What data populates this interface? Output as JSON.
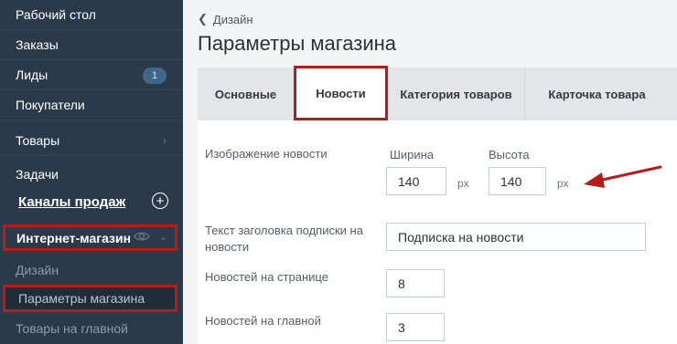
{
  "sidebar": {
    "items": [
      {
        "label": "Рабочий стол"
      },
      {
        "label": "Заказы"
      },
      {
        "label": "Лиды",
        "badge": "1"
      },
      {
        "label": "Покупатели"
      },
      {
        "label": "Товары"
      },
      {
        "label": "Задачи"
      }
    ],
    "channels_label": "Каналы продаж",
    "shop_label": "Интернет-магазин",
    "sub_items": [
      {
        "label": "Дизайн"
      },
      {
        "label": "Параметры магазина"
      },
      {
        "label": "Товары на главной"
      }
    ]
  },
  "breadcrumb": {
    "label": "Дизайн"
  },
  "page": {
    "title": "Параметры магазина"
  },
  "tabs": [
    {
      "label": "Основные"
    },
    {
      "label": "Новости"
    },
    {
      "label": "Категория товаров"
    },
    {
      "label": "Карточка товара"
    }
  ],
  "form": {
    "news_image": {
      "label": "Изображение новости",
      "width_label": "Ширина",
      "width_value": "140",
      "height_label": "Высота",
      "height_value": "140",
      "unit": "px"
    },
    "subscribe_title": {
      "label": "Текст заголовка подписки на новости",
      "value": "Подписка на новости"
    },
    "news_per_page": {
      "label": "Новостей на странице",
      "value": "8"
    },
    "news_on_main": {
      "label": "Новостей на главной",
      "value": "3"
    }
  },
  "colors": {
    "sidebar_bg": "#2b3a4a",
    "highlight_red": "#b51d1d",
    "main_bg": "#f3f4f5"
  }
}
